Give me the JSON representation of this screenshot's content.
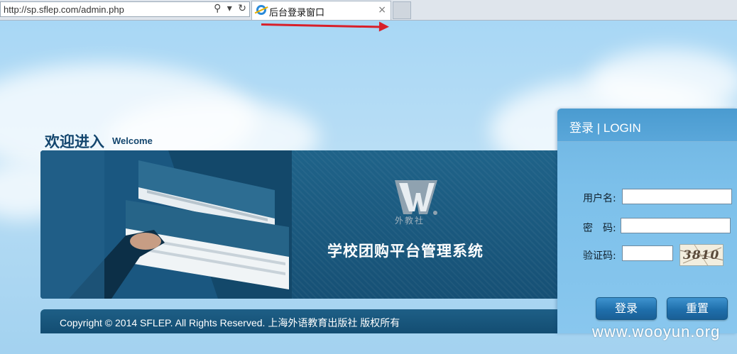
{
  "browser": {
    "address_url": "http://sp.sflep.com/admin.php",
    "tab_title": "后台登录窗口",
    "tab_close": "×",
    "address_icons": [
      "⚲",
      "▾",
      "↻"
    ]
  },
  "welcome": {
    "cn": "欢迎进入",
    "en": "Welcome"
  },
  "banner": {
    "logo_text": "外教社",
    "system_title": "学校团购平台管理系统"
  },
  "footer": {
    "copyright": "Copyright © 2014 SFLEP. All Rights Reserved. 上海外语教育出版社 版权所有"
  },
  "login": {
    "title": "登录 | LOGIN",
    "username_label": "用户名:",
    "username_value": "",
    "password_label": "密　码:",
    "password_value": "",
    "captcha_label": "验证码:",
    "captcha_value": "",
    "captcha_image_text": "3810",
    "login_button": "登录",
    "reset_button": "重置"
  },
  "watermark": "www.wooyun.org",
  "colors": {
    "banner_blue": "#134d72",
    "login_panel": "#7cc0ea",
    "annotation_arrow": "#d8202a"
  }
}
